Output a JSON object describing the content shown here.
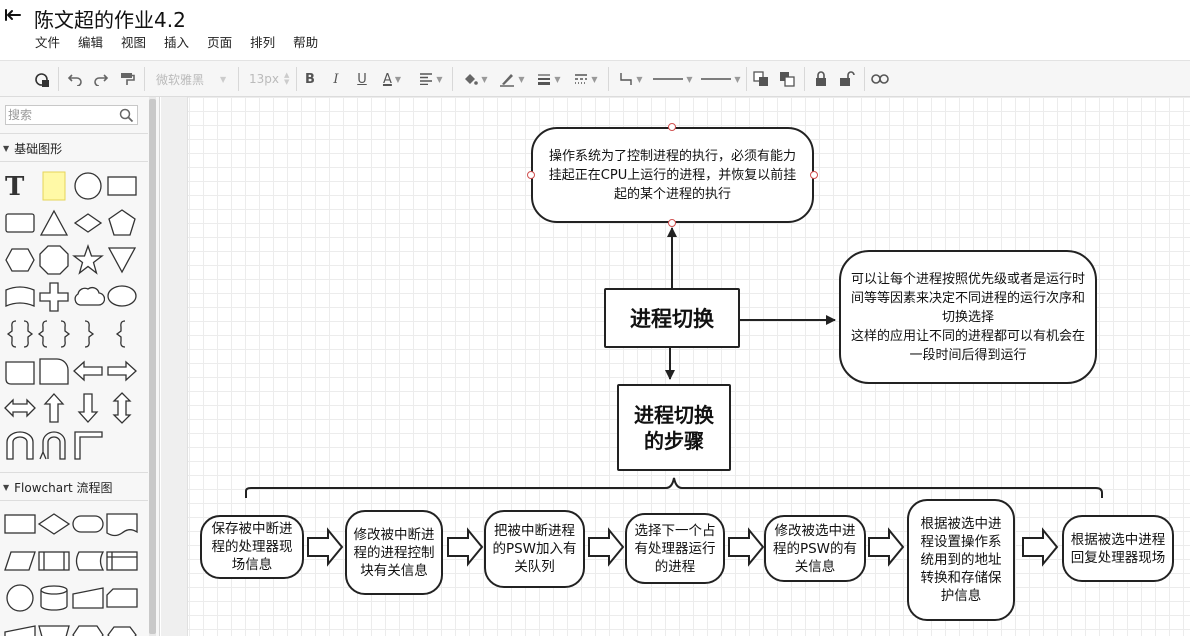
{
  "document": {
    "title": "陈文超的作业4.2"
  },
  "menu": [
    "文件",
    "编辑",
    "视图",
    "插入",
    "页面",
    "排列",
    "帮助"
  ],
  "toolbar": {
    "font_family": "微软雅黑",
    "font_size": "13px",
    "bold_glyph": "B",
    "italic_glyph": "I",
    "underline_glyph": "U",
    "font_color_glyph": "A",
    "colors": {
      "accent": "#3d6fc6",
      "stroke": "#222222",
      "grid": "#ececec"
    }
  },
  "sidebar": {
    "search_placeholder": "搜索",
    "section_basic": "基础图形",
    "section_flowchart": "Flowchart 流程图",
    "basic_shapes": [
      "text-shape",
      "note-shape",
      "circle-shape",
      "rectangle-shape",
      "rounded-rect-shape",
      "triangle-shape",
      "diamond-shape",
      "pentagon-shape",
      "hexagon-shape",
      "octagon-shape",
      "star-shape",
      "inverted-triangle-shape",
      "wave-shape",
      "cross-shape",
      "cloud-shape",
      "speech-bubble-shape",
      "left-brace-shape",
      "bracket-pair-shape",
      "right-brace-shape",
      "small-brace-shape",
      "tape-shape",
      "callout-corner-shape",
      "left-arrow-shape",
      "right-arrow-shape",
      "double-arrow-shape",
      "up-arrow-shape",
      "down-arrow-shape",
      "vertical-double-arrow-shape",
      "u-turn-arrow-shape",
      "u-turn-arrow-2-shape",
      "corner-shape"
    ],
    "flow_shapes": [
      "process-shape",
      "decision-shape",
      "terminator-shape",
      "document-shape",
      "data-shape",
      "predefined-process-shape",
      "stored-data-shape",
      "internal-storage-shape",
      "connector-shape",
      "database-shape",
      "manual-input-shape",
      "card-shape",
      "trapezoid-shape",
      "manual-operation-shape",
      "preparation-shape",
      "hex-preparation-shape"
    ]
  },
  "diagram": {
    "top_note": "操作系统为了控制进程的执行，必须有能力挂起正在CPU上运行的进程，并恢复以前挂起的某个进程的执行",
    "center_title": "进程切换",
    "right_note_line1": "可以让每个进程按照优先级或者是运行时间等等因素来决定不同进程的运行次序和切换选择",
    "right_note_line2": "这样的应用让不同的进程都可以有机会在一段时间后得到运行",
    "steps_title": "进程切换的步骤",
    "steps": [
      "保存被中断进程的处理器现场信息",
      "修改被中断进程的进程控制块有关信息",
      "把被中断进程的PSW加入有关队列",
      "选择下一个占有处理器运行的进程",
      "修改被选中进程的PSW的有关信息",
      "根据被选中进程设置操作系统用到的地址转换和存储保护信息",
      "根据被选中进程回复处理器现场"
    ]
  }
}
